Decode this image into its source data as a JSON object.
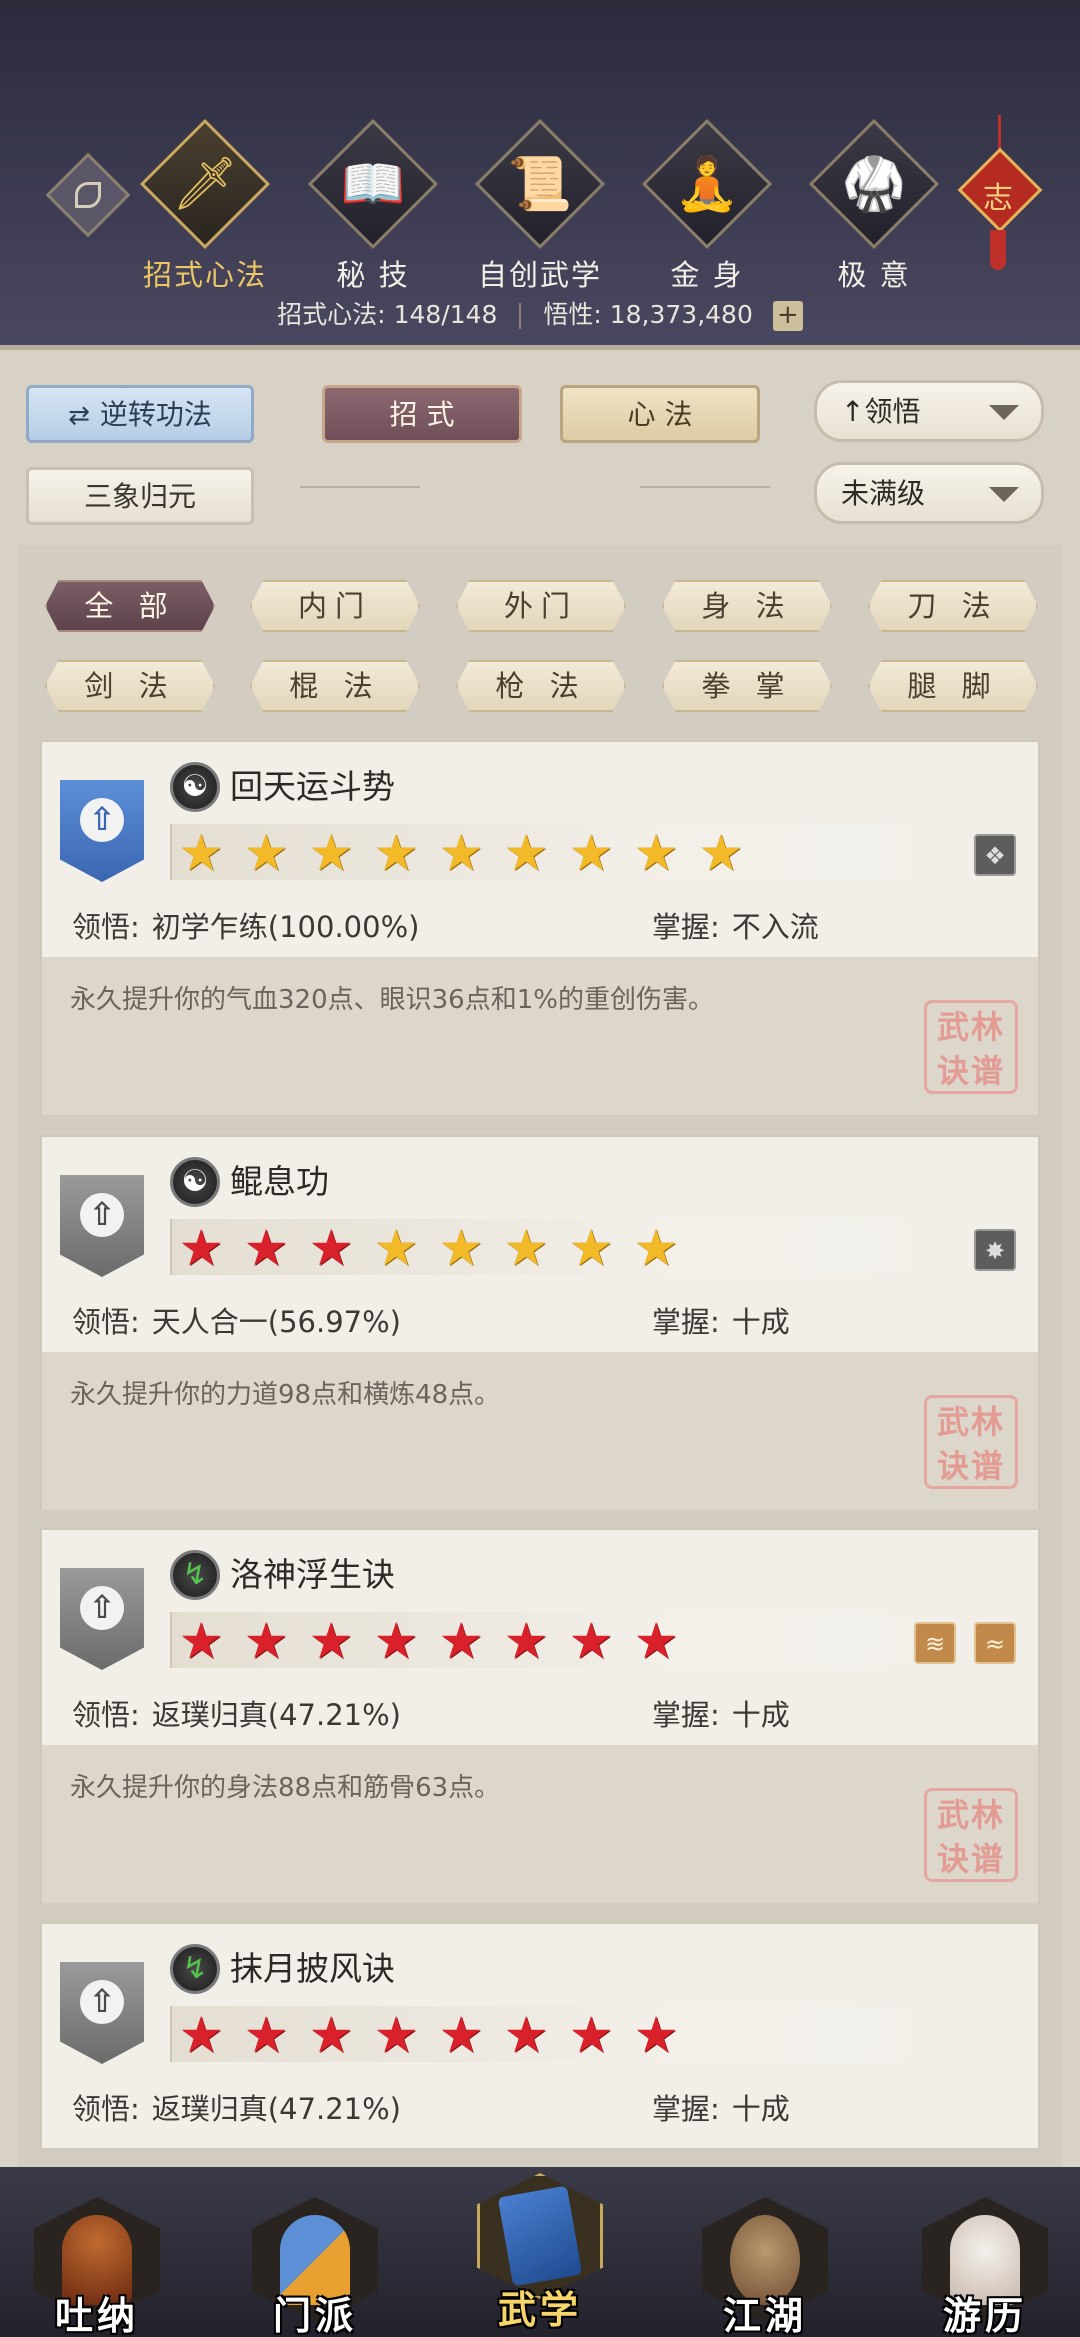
{
  "top_tabs": [
    {
      "label": "招式心法",
      "icon": "sword-icon",
      "glyph": "🗡"
    },
    {
      "label": "秘 技",
      "icon": "book-icon",
      "glyph": "📖"
    },
    {
      "label": "自创武学",
      "icon": "scroll-icon",
      "glyph": "📜"
    },
    {
      "label": "金 身",
      "icon": "meditation-icon",
      "glyph": "🧘"
    },
    {
      "label": "极 意",
      "icon": "fighter-icon",
      "glyph": "🥋"
    }
  ],
  "knot_char": "志",
  "stats": {
    "skills_label": "招式心法:",
    "skills_value": "148/148",
    "insight_label": "悟性:",
    "insight_value": "18,373,480"
  },
  "controls": {
    "reverse_label": "逆转功法",
    "tab_moves": "招 式",
    "tab_heart": "心 法",
    "sort_label": "领悟",
    "filter_label": "未满级",
    "sanxiang_label": "三象归元"
  },
  "filters": [
    "全 部",
    "内门",
    "外门",
    "身 法",
    "刀 法",
    "剑 法",
    "棍 法",
    "枪 法",
    "拳 掌",
    "腿 脚"
  ],
  "skills": [
    {
      "name": "回天运斗势",
      "icon": "yin-yang-icon",
      "glyph": "☯",
      "stars": [
        "gold",
        "gold",
        "gold",
        "gold",
        "gold",
        "gold",
        "gold",
        "gold",
        "gold"
      ],
      "comprehension_label": "领悟:",
      "comprehension": "初学乍练(100.00%)",
      "mastery_label": "掌握:",
      "mastery": "不入流",
      "description": "永久提升你的气血320点、眼识36点和1%的重创伤害。",
      "badges": [
        {
          "type": "grey",
          "glyph": "❖"
        }
      ],
      "banner": "blue"
    },
    {
      "name": "鲲息功",
      "icon": "yin-yang-icon",
      "glyph": "☯",
      "stars": [
        "red",
        "red",
        "red",
        "gold",
        "gold",
        "gold",
        "gold",
        "gold"
      ],
      "comprehension_label": "领悟:",
      "comprehension": "天人合一(56.97%)",
      "mastery_label": "掌握:",
      "mastery": "十成",
      "description": "永久提升你的力道98点和横炼48点。",
      "badges": [
        {
          "type": "grey",
          "glyph": "✸"
        }
      ],
      "banner": "gray"
    },
    {
      "name": "洛神浮生诀",
      "icon": "boot-icon",
      "glyph": "↯",
      "stars": [
        "red",
        "red",
        "red",
        "red",
        "red",
        "red",
        "red",
        "red"
      ],
      "comprehension_label": "领悟:",
      "comprehension": "返璞归真(47.21%)",
      "mastery_label": "掌握:",
      "mastery": "十成",
      "description": "永久提升你的身法88点和筋骨63点。",
      "badges": [
        {
          "type": "tan",
          "glyph": "≋"
        },
        {
          "type": "tan",
          "glyph": "≈"
        }
      ],
      "banner": "gray"
    },
    {
      "name": "抹月披风诀",
      "icon": "boot-icon",
      "glyph": "↯",
      "stars": [
        "red",
        "red",
        "red",
        "red",
        "red",
        "red",
        "red",
        "red"
      ],
      "comprehension_label": "领悟:",
      "comprehension": "返璞归真(47.21%)",
      "mastery_label": "掌握:",
      "mastery": "十成",
      "description": "",
      "badges": [],
      "banner": "gray"
    }
  ],
  "seal_text": "武林诀谱",
  "bottom_nav": [
    {
      "label": "吐纳",
      "icon": "monk-icon"
    },
    {
      "label": "门派",
      "icon": "sect-banner-icon"
    },
    {
      "label": "武学",
      "icon": "martial-book-icon"
    },
    {
      "label": "江湖",
      "icon": "straw-hat-icon"
    },
    {
      "label": "游历",
      "icon": "horse-icon"
    }
  ],
  "colors": {
    "header_bg": "#3d3c52",
    "active_gold": "#ecc664",
    "active_tab": "#6e4e58",
    "star_gold": "#f2b928",
    "star_red": "#d8212a"
  }
}
